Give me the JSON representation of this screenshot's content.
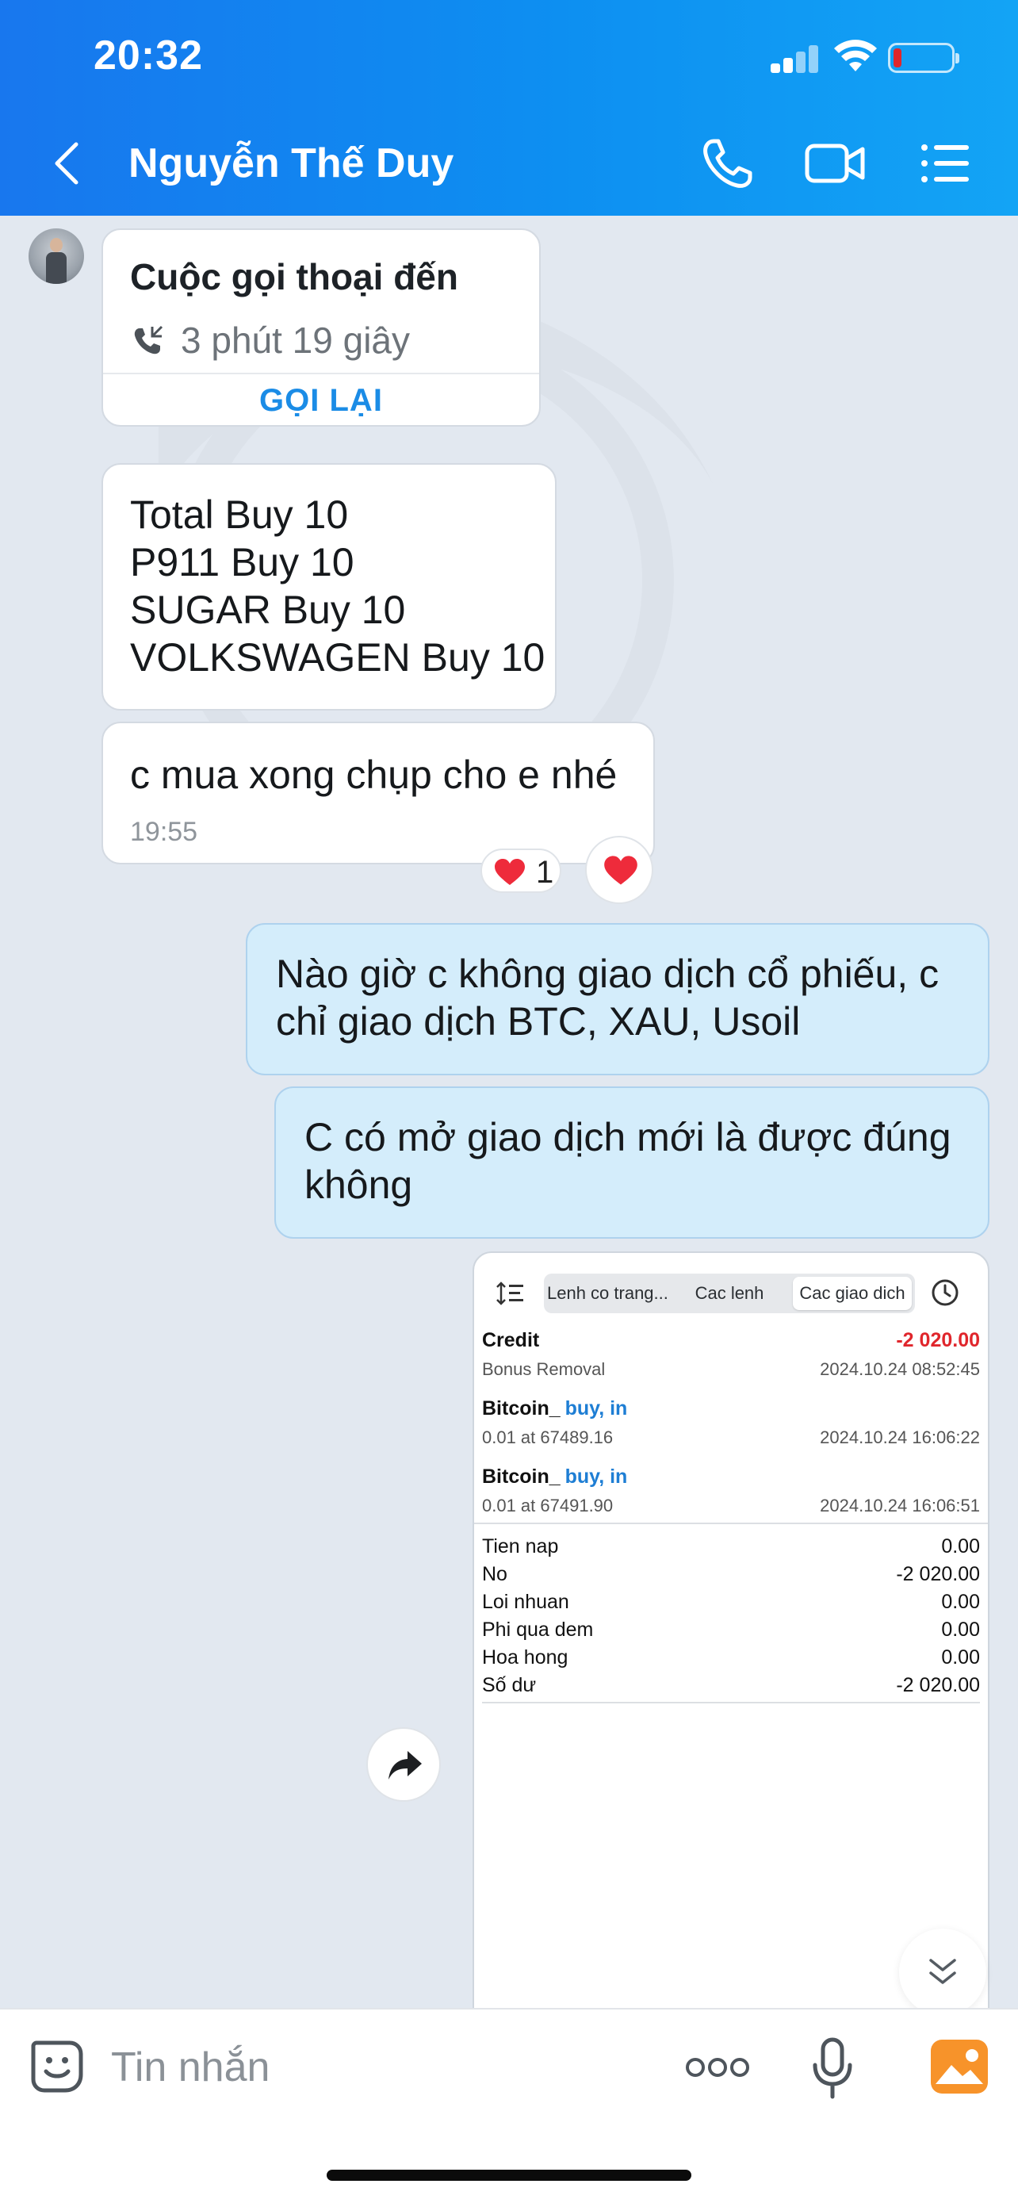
{
  "status_bar": {
    "time": "20:32"
  },
  "header": {
    "contact_name": "Nguyễn Thế Duy"
  },
  "messages": {
    "call_card": {
      "title": "Cuộc gọi thoại đến",
      "duration": "3 phút 19 giây",
      "callback_label": "GỌI LẠI"
    },
    "orders": {
      "lines": [
        "Total Buy 10",
        "P911 Buy 10",
        "SUGAR Buy 10",
        "VOLKSWAGEN Buy 10"
      ]
    },
    "msg3": {
      "text": "c mua xong chụp cho e nhé",
      "time": "19:55",
      "reaction_count": "1"
    },
    "msg4": {
      "text": "Nào giờ c không giao dịch cổ phiếu, c chỉ giao dịch BTC, XAU, Usoil"
    },
    "msg5": {
      "text": "C có mở giao dịch mới là được đúng không"
    }
  },
  "screenshot": {
    "tabs": [
      "Lenh co trang...",
      "Cac lenh",
      "Cac giao dich"
    ],
    "active_tab": "Cac giao dich",
    "trades": [
      {
        "name": "Credit",
        "direction": "",
        "amount": "-2 020.00",
        "sub": "Bonus Removal",
        "date": "2024.10.24 08:52:45"
      },
      {
        "name": "Bitcoin_",
        "direction": "buy, in",
        "amount": "",
        "sub": "0.01 at 67489.16",
        "date": "2024.10.24 16:06:22"
      },
      {
        "name": "Bitcoin_",
        "direction": "buy, in",
        "amount": "",
        "sub": "0.01 at 67491.90",
        "date": "2024.10.24 16:06:51"
      }
    ],
    "summary": [
      {
        "label": "Tien nap",
        "value": "0.00"
      },
      {
        "label": "No",
        "value": "-2 020.00"
      },
      {
        "label": "Loi nhuan",
        "value": "0.00"
      },
      {
        "label": "Phi qua dem",
        "value": "0.00"
      },
      {
        "label": "Hoa hong",
        "value": "0.00"
      },
      {
        "label": "Số dư",
        "value": "-2 020.00"
      }
    ]
  },
  "input": {
    "placeholder": "Tin nhắn"
  },
  "colors": {
    "header_start": "#1877ee",
    "header_end": "#13a4f5",
    "accent": "#1b8ce6",
    "outgoing_bubble": "#d4edfb",
    "negative": "#e0262c"
  },
  "icons": [
    "back-icon",
    "phone-icon",
    "video-icon",
    "menu-icon",
    "call-incoming-icon",
    "heart-icon",
    "share-icon",
    "chevron-double-down-icon",
    "sticker-icon",
    "more-icon",
    "mic-icon",
    "gallery-icon"
  ]
}
